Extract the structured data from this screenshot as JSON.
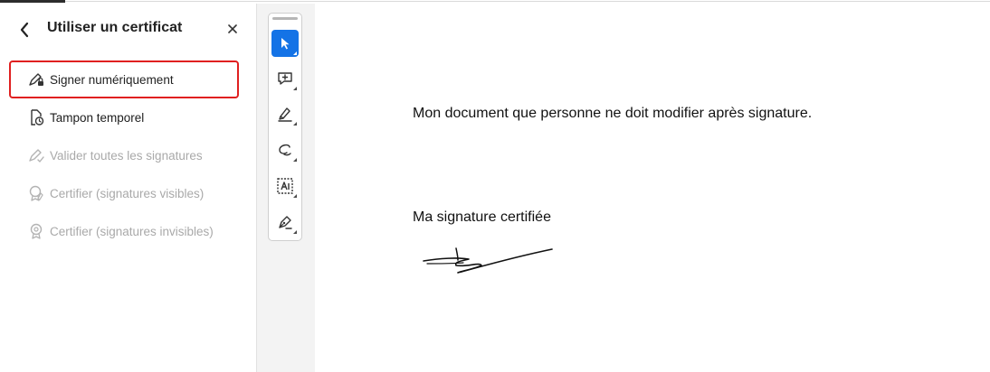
{
  "panel": {
    "title": "Utiliser un certificat",
    "items": [
      {
        "label": "Signer numériquement",
        "icon": "pen-lock-icon",
        "state": "highlighted"
      },
      {
        "label": "Tampon temporel",
        "icon": "document-clock-icon",
        "state": "enabled"
      },
      {
        "label": "Valider toutes les signatures",
        "icon": "pen-check-icon",
        "state": "disabled"
      },
      {
        "label": "Certifier (signatures visibles)",
        "icon": "certify-visible-icon",
        "state": "disabled"
      },
      {
        "label": "Certifier (signatures invisibles)",
        "icon": "certify-invisible-icon",
        "state": "disabled"
      }
    ]
  },
  "toolbar": {
    "tools": [
      {
        "name": "select-tool",
        "icon": "cursor-arrow-icon",
        "selected": true
      },
      {
        "name": "comment-tool",
        "icon": "comment-plus-icon",
        "selected": false
      },
      {
        "name": "highlight-tool",
        "icon": "highlighter-pen-icon",
        "selected": false
      },
      {
        "name": "draw-tool",
        "icon": "freehand-draw-icon",
        "selected": false
      },
      {
        "name": "text-recognition-tool",
        "icon": "text-box-icon",
        "selected": false
      },
      {
        "name": "sign-tool",
        "icon": "fountain-pen-icon",
        "selected": false
      }
    ]
  },
  "document": {
    "body_text": "Mon document que personne ne doit modifier après signature.",
    "signature_label": "Ma signature certifiée"
  },
  "colors": {
    "accent": "#1473e6",
    "highlight_box": "#e02020",
    "disabled_text": "#a9a9a9"
  }
}
